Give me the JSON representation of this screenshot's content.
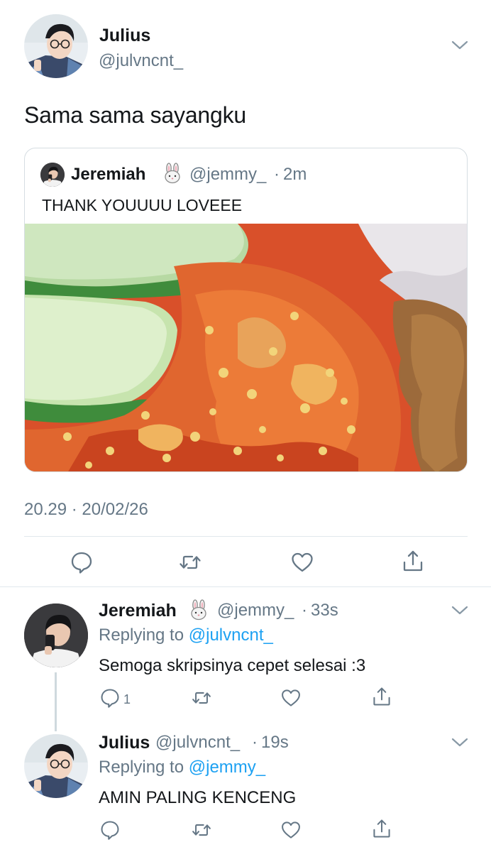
{
  "main_tweet": {
    "author_name": "Julius",
    "author_handle": "@julvncnt_",
    "text": "Sama sama sayangku",
    "timestamp": "20.29 · 20/02/26",
    "quote": {
      "author_name": "Jeremiah",
      "author_emoji": "bunny-emoji",
      "author_handle": "@jemmy_",
      "separator": "·",
      "time": "2m",
      "text": "THANK YOUUUU LOVEEE",
      "image": "photo of sambal chili with cucumber slices and fried chicken"
    }
  },
  "replies": [
    {
      "author_name": "Jeremiah",
      "author_emoji": "bunny-emoji",
      "author_handle": "@jemmy_",
      "separator": "·",
      "time": "33s",
      "replying_prefix": "Replying to ",
      "replying_to": "@julvncnt_",
      "text": "Semoga skripsinya cepet selesai :3",
      "reply_count": "1"
    },
    {
      "author_name": "Julius",
      "author_handle": "@julvncnt_",
      "separator": "·",
      "time": "19s",
      "replying_prefix": "Replying to ",
      "replying_to": "@jemmy_",
      "text": "AMIN PALING KENCENG",
      "reply_count": ""
    }
  ],
  "icons": {
    "reply": "reply-icon",
    "retweet": "retweet-icon",
    "like": "like-icon",
    "share": "share-icon",
    "more": "chevron-down-icon"
  },
  "colors": {
    "text": "#14171a",
    "muted": "#657786",
    "link": "#1da1f2",
    "divider": "#e1e8ed"
  }
}
